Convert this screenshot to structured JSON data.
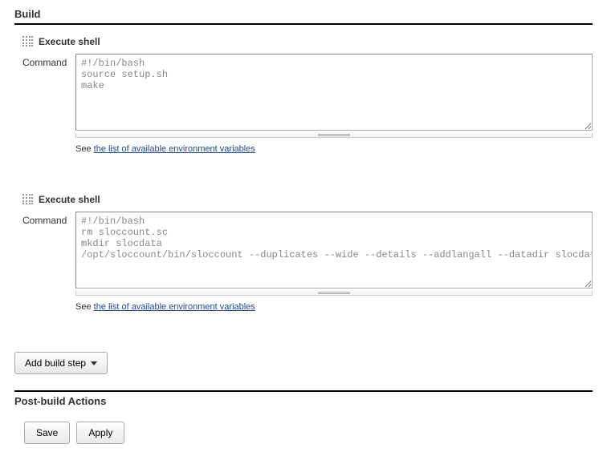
{
  "sections": {
    "build_header": "Build",
    "post_build_header": "Post-build Actions"
  },
  "steps": [
    {
      "title": "Execute shell",
      "command_label": "Command",
      "command_value": "#!/bin/bash\nsource setup.sh\nmake",
      "help_prefix": "See ",
      "help_link_text": "the list of available environment variables"
    },
    {
      "title": "Execute shell",
      "command_label": "Command",
      "command_value": "#!/bin/bash\nrm sloccount.sc\nmkdir slocdata\n/opt/sloccount/bin/sloccount --duplicates --wide --details --addlangall --datadir slocdata .",
      "help_prefix": "See ",
      "help_link_text": "the list of available environment variables"
    }
  ],
  "buttons": {
    "add_step": "Add build step",
    "save": "Save",
    "apply": "Apply"
  }
}
